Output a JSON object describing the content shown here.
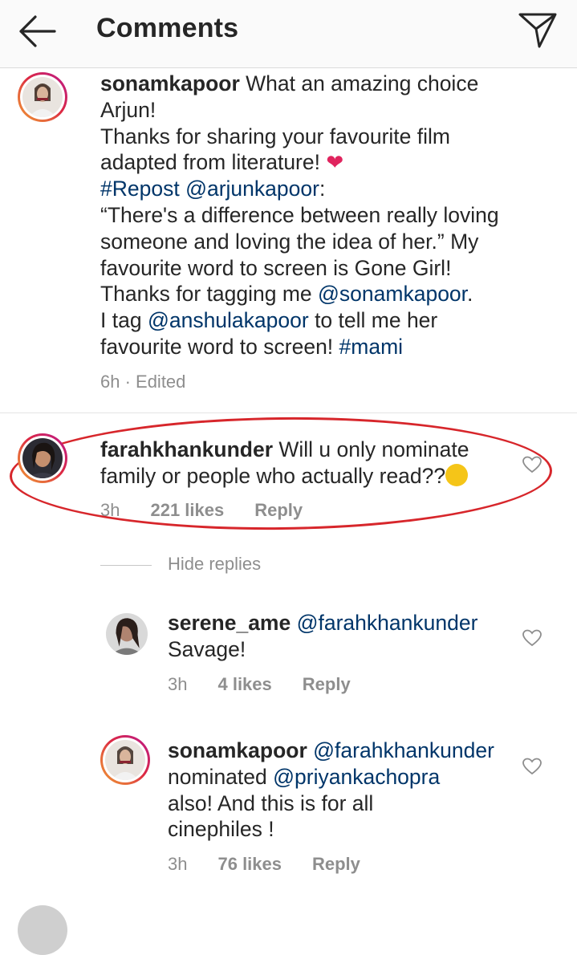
{
  "header": {
    "title": "Comments",
    "back_icon": "arrow-left-icon",
    "send_icon": "paper-plane-icon"
  },
  "caption": {
    "username": "sonamkapoor",
    "lines": [
      " What an amazing choice",
      "Arjun!",
      "Thanks for sharing your favourite film",
      "adapted from literature! "
    ],
    "hashtag_repost": "#Repost",
    "mention_arjun": "@arjunkapoor",
    "after_mention": ":",
    "quote_lines": [
      "“There's a difference between really loving",
      "someone and loving the idea of her.” My",
      "favourite word to screen is Gone Girl!",
      "Thanks for tagging me "
    ],
    "mention_sonam": "@sonamkapoor",
    "period": ".",
    "tag_prefix": "I tag ",
    "mention_anshula": "@anshulakapoor",
    "tag_suffix": " to tell me her",
    "last_line": "favourite word to screen! ",
    "hashtag_mami": "#mami",
    "time": "6h · Edited"
  },
  "comments": [
    {
      "username": "farahkhankunder",
      "text_line1": " Will u only nominate",
      "text_line2": "family or people who actually read??",
      "time": "3h",
      "likes": "221 likes",
      "reply": "Reply"
    }
  ],
  "hide_replies": "Hide replies",
  "replies": [
    {
      "username": "serene_ame",
      "mention": "@farahkhankunder",
      "text": "Savage!",
      "time": "3h",
      "likes": "4 likes",
      "reply": "Reply"
    },
    {
      "username": "sonamkapoor",
      "mention": "@farahkhankunder",
      "line2_prefix": "nominated ",
      "line2_mention": "@priyankachopra",
      "line3": "also! And this is for all",
      "line4": "cinephiles !",
      "time": "3h",
      "likes": "76 likes",
      "reply": "Reply"
    }
  ],
  "colors": {
    "link": "#003569",
    "meta": "#8e8e8e",
    "highlight": "#d7262b"
  }
}
